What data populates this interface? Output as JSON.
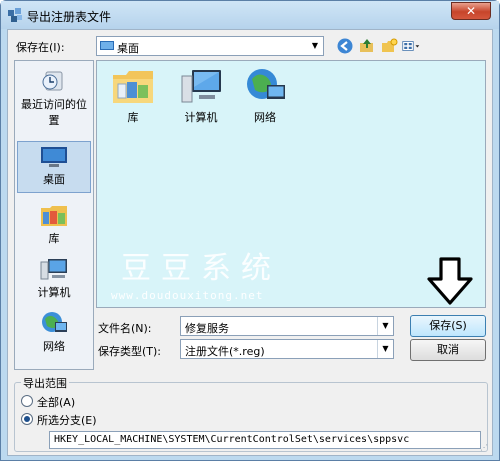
{
  "window": {
    "title": "导出注册表文件",
    "close": "✕"
  },
  "save_in": {
    "label": "保存在(I):",
    "value": "桌面"
  },
  "places": [
    {
      "label": "最近访问的位置",
      "icon": "recent-places-icon"
    },
    {
      "label": "桌面",
      "icon": "desktop-icon"
    },
    {
      "label": "库",
      "icon": "libraries-icon"
    },
    {
      "label": "计算机",
      "icon": "computer-icon"
    },
    {
      "label": "网络",
      "icon": "network-icon"
    }
  ],
  "items": [
    {
      "label": "库",
      "icon": "libraries-folder-icon"
    },
    {
      "label": "计算机",
      "icon": "computer-icon"
    },
    {
      "label": "网络",
      "icon": "network-icon"
    }
  ],
  "watermark": {
    "title": "豆豆系统",
    "url": "www.doudouxitong.net"
  },
  "file_name": {
    "label": "文件名(N):",
    "value": "修复服务"
  },
  "save_type": {
    "label": "保存类型(T):",
    "value": "注册文件(*.reg)"
  },
  "buttons": {
    "save": "保存(S)",
    "cancel": "取消"
  },
  "export_range": {
    "title": "导出范围",
    "all_label": "全部(A)",
    "branch_label": "所选分支(E)",
    "branch_value": "HKEY_LOCAL_MACHINE\\SYSTEM\\CurrentControlSet\\services\\sppsvc",
    "selected": "branch"
  },
  "colors": {
    "view_bg": "#d8f4f9",
    "titlebar": "#cfe5f6",
    "close": "#c7452b"
  }
}
